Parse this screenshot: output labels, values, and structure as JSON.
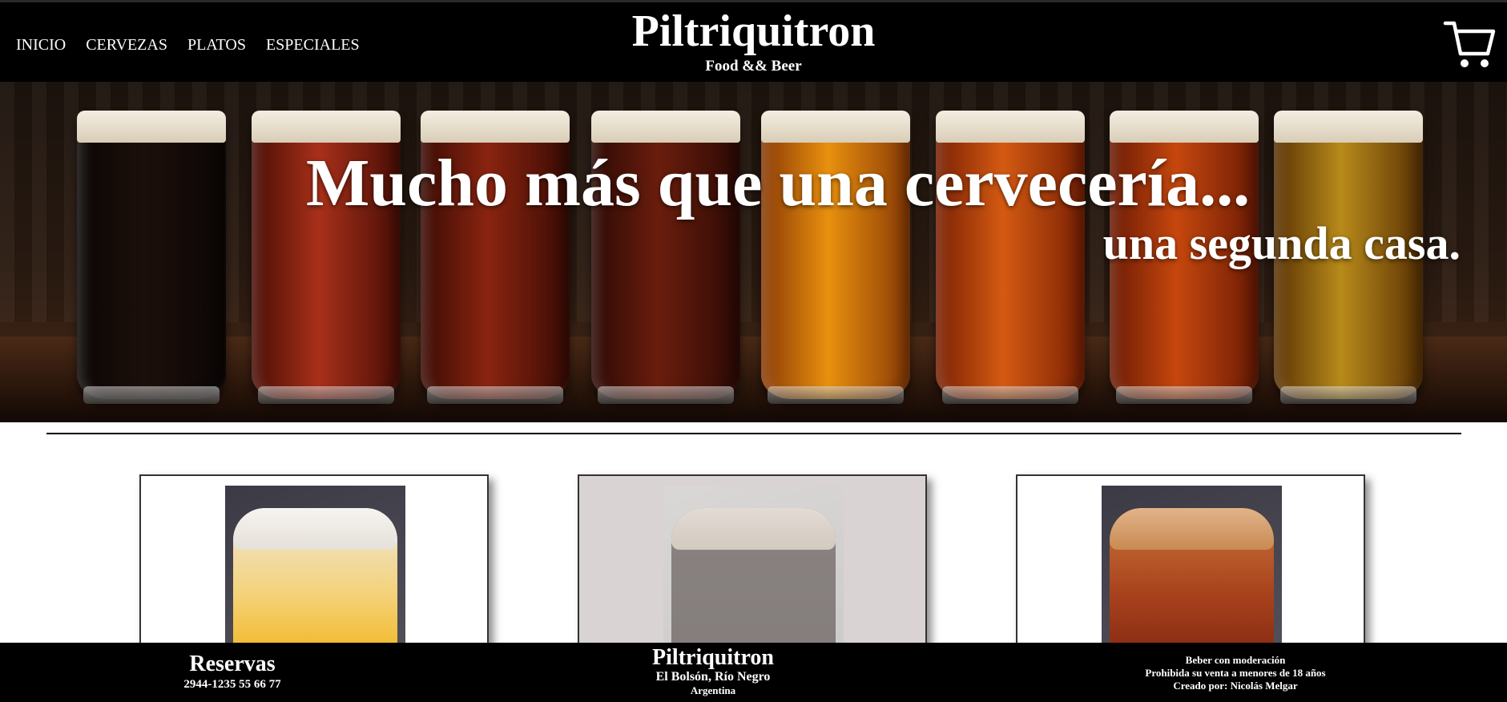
{
  "nav": {
    "items": [
      "INICIO",
      "CERVEZAS",
      "PLATOS",
      "ESPECIALES"
    ]
  },
  "brand": {
    "title": "Piltriquitron",
    "subtitle": "Food && Beer"
  },
  "header": {
    "cart_icon": "shopping-cart-icon"
  },
  "hero": {
    "headline": "Mucho más que una cervecería...",
    "subline": "una segunda casa."
  },
  "cards": [
    {
      "name": "beer-card-lager",
      "beer_color": "#f2b92a",
      "hover": false
    },
    {
      "name": "beer-card-stout",
      "beer_color": "#1a1412",
      "hover": true
    },
    {
      "name": "beer-card-red",
      "beer_color": "#a8421c",
      "hover": false
    }
  ],
  "footer": {
    "reservas_title": "Reservas",
    "reservas_phone": "2944-1235 55 66 77",
    "brand_title": "Piltriquitron",
    "location": "El Bolsón, Río Negro",
    "country": "Argentina",
    "notice_1": "Beber con moderación",
    "notice_2": "Prohibida su venta a menores de 18 años",
    "credit": "Creado por: Nicolás Melgar"
  }
}
